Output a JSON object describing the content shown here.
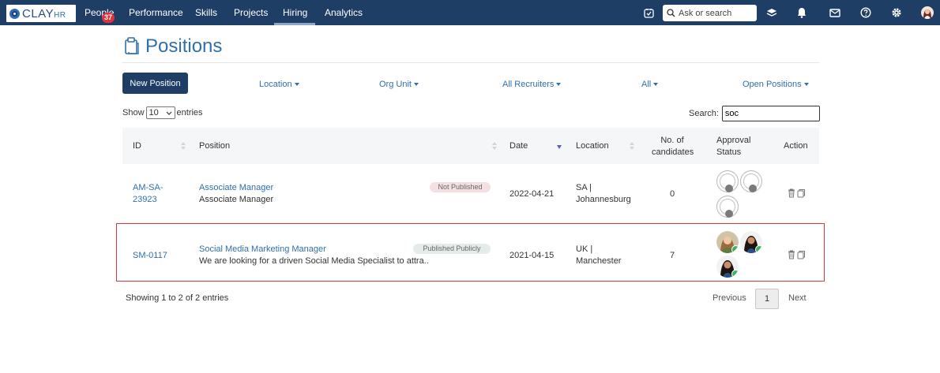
{
  "nav": {
    "logo_main": "CLAY",
    "logo_sub": "HR",
    "items": [
      "People",
      "Performance",
      "Skills",
      "Projects",
      "Hiring",
      "Analytics"
    ],
    "people_badge": "37",
    "search_placeholder": "Ask or search"
  },
  "page": {
    "title": "Positions"
  },
  "toolbar": {
    "new_button": "New Position",
    "filters": [
      "Location",
      "Org Unit",
      "All Recruiters",
      "All",
      "Open Positions"
    ]
  },
  "table_controls": {
    "show_label": "Show",
    "entries_value": "10",
    "entries_label": "entries",
    "search_label": "Search:",
    "search_value": "soc"
  },
  "table": {
    "headers": {
      "id": "ID",
      "position": "Position",
      "date": "Date",
      "location": "Location",
      "candidates_1": "No. of",
      "candidates_2": "candidates",
      "approval_1": "Approval",
      "approval_2": "Status",
      "action": "Action"
    },
    "rows": [
      {
        "id_1": "AM-SA-",
        "id_2": "23923",
        "title": "Associate Manager",
        "subtitle": "Associate Manager",
        "status": "Not Published",
        "date": "2022-04-21",
        "location_1": "SA |",
        "location_2": "Johannesburg",
        "candidates": "0"
      },
      {
        "id_1": "SM-0117",
        "title": "Social Media Marketing Manager",
        "subtitle": "We are looking for a driven Social Media Specialist to attra...",
        "status": "Published Publicly",
        "date": "2021-04-15",
        "location_1": "UK |",
        "location_2": "Manchester",
        "candidates": "7"
      }
    ]
  },
  "footer": {
    "info": "Showing 1 to 2 of 2 entries",
    "previous": "Previous",
    "page": "1",
    "next": "Next"
  },
  "colors": {
    "navbar": "#1f3e66",
    "link": "#2f6fae",
    "highlight": "#e0333b",
    "approved": "#3cb464"
  }
}
